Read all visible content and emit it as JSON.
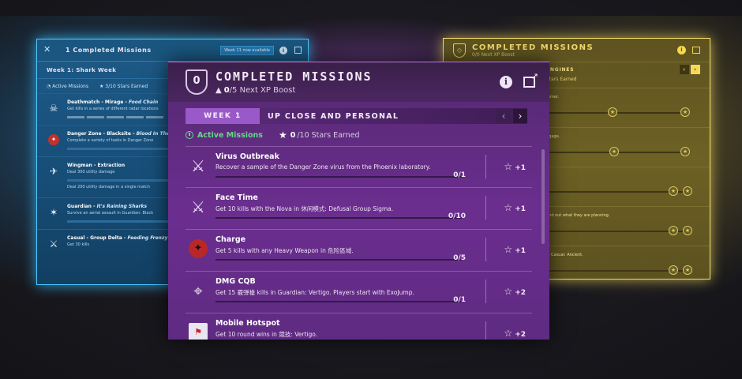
{
  "left_panel": {
    "title": "1 Completed Missions",
    "badge": "Week 11 now available",
    "week": "Week 1: Shark Week",
    "status_active": "Active Missions",
    "status_stars": "3/10 Stars Earned",
    "missions": [
      {
        "mode": "Deathmatch - Mirage",
        "name": "Food Chain",
        "desc": "Get kills in a series of different radar locations"
      },
      {
        "mode": "Danger Zone - Blacksite",
        "name": "Blood In The Water",
        "desc": "Complete a variety of tasks in Danger Zone"
      },
      {
        "mode": "Wingman - Extraction",
        "name": "",
        "desc": "Deal 300 utility damage"
      },
      {
        "mode": "Guardian",
        "name": "It's Raining Sharks",
        "desc": "Survive an aerial assault in Guardian: Black"
      },
      {
        "mode": "Casual - Group Delta",
        "name": "Feeding Frenzy",
        "desc": "Get 30 kills"
      }
    ],
    "extra_desc": "Deal 200 utility damage in a single match"
  },
  "right_panel": {
    "title": "COMPLETED MISSIONS",
    "subtitle": "0/0 Next XP Boost",
    "week_name": "ENGINES",
    "stars": "Stars Earned",
    "rows": [
      "mmer.",
      "ggage.",
      "e.",
      "find out what they are planning.",
      "in Casual: Ancient."
    ]
  },
  "center_panel": {
    "shield_label": "0",
    "title": "COMPLETED MISSIONS",
    "xp_count": "0",
    "xp_label": "/5 Next XP Boost",
    "week_tab": "WEEK 1",
    "week_name": "UP CLOSE AND PERSONAL",
    "active_label": "Active Missions",
    "stars_count": "0",
    "stars_label": "/10 Stars Earned",
    "missions": [
      {
        "title": "Virus Outbreak",
        "desc": "Recover a sample of the Danger Zone virus from the Phoenix laboratory.",
        "progress": "0/1",
        "reward": "+1",
        "icon": "crossed-knives-icon"
      },
      {
        "title": "Face Time",
        "desc": "Get 10 kills with the Nova in 休闲模式: Defusal Group Sigma.",
        "progress": "0/10",
        "reward": "+1",
        "icon": "crossed-knives-icon"
      },
      {
        "title": "Charge",
        "desc": "Get 5 kills with any Heavy Weapon in 危险區域.",
        "progress": "0/5",
        "reward": "+1",
        "icon": "danger-zone-icon"
      },
      {
        "title": "DMG CQB",
        "desc": "Get 15 霰弹槍 kills in Guardian: Vertigo. Players start with ExoJump.",
        "progress": "0/1",
        "reward": "+2",
        "icon": "crosshair-icon"
      },
      {
        "title": "Mobile Hotspot",
        "desc": "Get 10 round wins in 競技: Vertigo.",
        "progress": "",
        "reward": "+2",
        "icon": "flag-icon"
      }
    ]
  }
}
